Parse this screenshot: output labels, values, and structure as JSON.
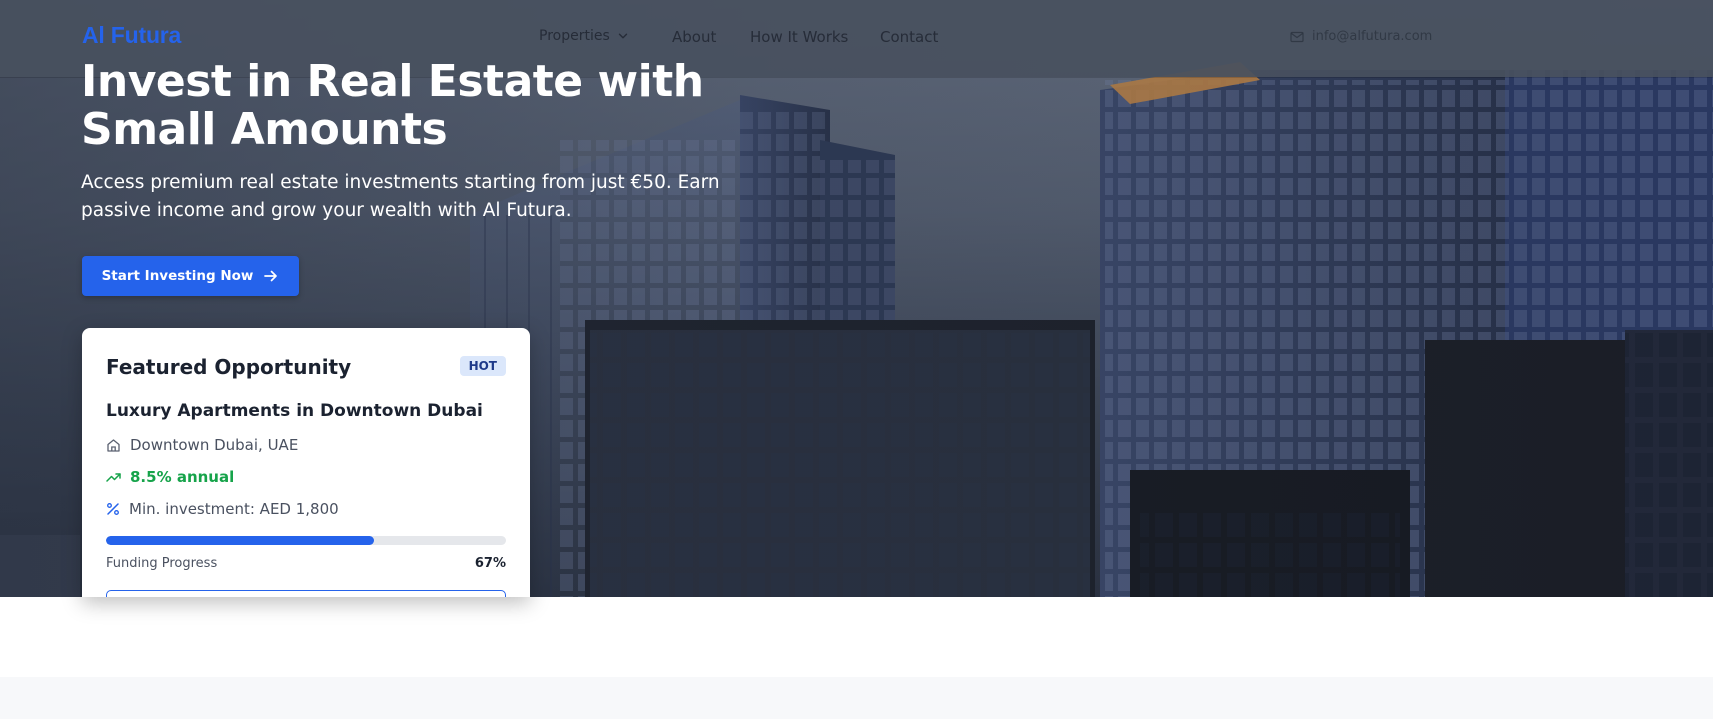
{
  "colors": {
    "accent": "#2563eb",
    "success": "#16a34a",
    "badge_bg": "#dbe7fb",
    "navbar_bg": "#48505e"
  },
  "navbar": {
    "logo": "Al Futura",
    "items": [
      {
        "label": "Properties",
        "icon": "chevron-down-icon"
      },
      {
        "label": "About"
      },
      {
        "label": "How It Works"
      },
      {
        "label": "Contact"
      }
    ],
    "email": {
      "label": "info@alfutura.com",
      "icon": "mail-icon"
    }
  },
  "hero": {
    "title": "Invest in Real Estate with Small Amounts",
    "subtitle": "Access premium real estate investments starting from just €50. Earn passive income and grow your wealth with Al Futura.",
    "cta_label": "Start Investing Now",
    "cta_icon": "arrow-right-icon"
  },
  "featured": {
    "title": "Featured Opportunity",
    "badge": "HOT",
    "property_name": "Luxury Apartments in Downtown Dubai",
    "location": {
      "icon": "home-icon",
      "text": "Downtown Dubai, UAE"
    },
    "return": {
      "icon": "trending-up-icon",
      "text": "8.5% annual"
    },
    "min_investment": {
      "icon": "percent-icon",
      "text": "Min. investment: AED 1,800"
    },
    "progress": {
      "label": "Funding Progress",
      "percent_text": "67%",
      "value": 0.67
    }
  }
}
